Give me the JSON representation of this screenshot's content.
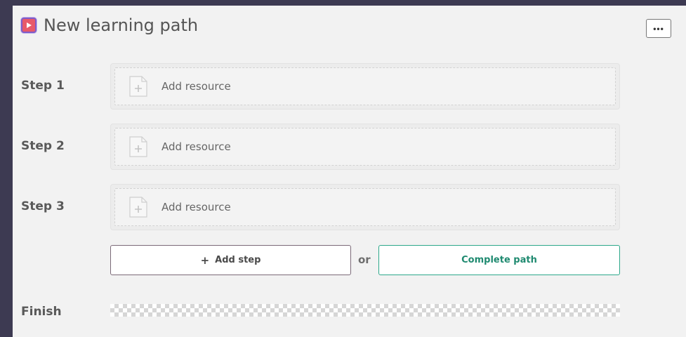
{
  "header": {
    "title": "New learning path",
    "icon": "play-icon",
    "more_label": "•••"
  },
  "steps": [
    {
      "label": "Step 1",
      "resource_label": "Add resource"
    },
    {
      "label": "Step 2",
      "resource_label": "Add resource"
    },
    {
      "label": "Step 3",
      "resource_label": "Add resource"
    }
  ],
  "actions": {
    "add_step_plus": "+",
    "add_step_label": "Add step",
    "or_label": "or",
    "complete_label": "Complete path"
  },
  "finish": {
    "label": "Finish"
  },
  "colors": {
    "background": "#3d3a52",
    "panel": "#f2f2f2",
    "icon_fill": "#e8596a",
    "icon_border": "#7e5cc9",
    "complete_accent": "#2da88a"
  }
}
